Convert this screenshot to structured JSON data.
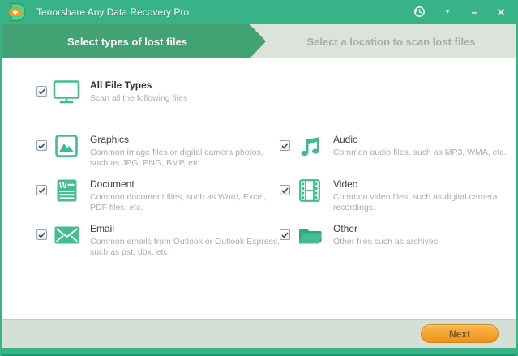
{
  "window": {
    "title": "Tenorshare Any Data Recovery Pro",
    "controls": {
      "history_icon": "history-restore-icon",
      "dropdown_glyph": "▼",
      "minimize_glyph": "–",
      "close_glyph": "✕"
    }
  },
  "steps": [
    {
      "label": "Select types of lost files",
      "active": true
    },
    {
      "label": "Select a location to scan lost files",
      "active": false
    }
  ],
  "file_types": {
    "all": {
      "title": "All File Types",
      "description": "Scan all the following files",
      "checked": true,
      "icon": "monitor-icon"
    },
    "items": [
      {
        "title": "Graphics",
        "description": "Common image files or digital camera photos, such as JPG, PNG, BMP, etc.",
        "checked": true,
        "icon": "image-icon"
      },
      {
        "title": "Audio",
        "description": "Common audio files, such as MP3, WMA, etc.",
        "checked": true,
        "icon": "music-notes-icon"
      },
      {
        "title": "Document",
        "description": "Common document files, such as Word, Excel, PDF files, etc.",
        "checked": true,
        "icon": "word-document-icon"
      },
      {
        "title": "Video",
        "description": "Common video files, such as digital camera recordings.",
        "checked": true,
        "icon": "film-strip-icon"
      },
      {
        "title": "Email",
        "description": "Common emails from Outlook or Outlook Express, such as pst, dbx, etc.",
        "checked": true,
        "icon": "envelope-icon"
      },
      {
        "title": "Other",
        "description": "Other files such as archives.",
        "checked": true,
        "icon": "open-folder-icon"
      }
    ]
  },
  "footer": {
    "next_label": "Next"
  },
  "colors": {
    "titlebar_green": "#38b287",
    "active_step_green": "#43a273",
    "inactive_step_bg": "#dbe3da",
    "icon_green": "#3fbd92",
    "footer_bg": "#d6dfd5",
    "next_button_orange": "#ee9118",
    "logo_orange": "#f59b1f"
  }
}
